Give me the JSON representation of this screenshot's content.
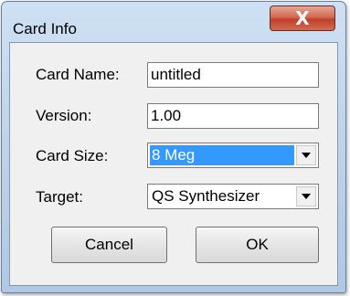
{
  "window": {
    "title": "Card Info",
    "close_label": "X"
  },
  "form": {
    "card_name": {
      "label": "Card Name:",
      "value": "untitled"
    },
    "version": {
      "label": "Version:",
      "value": "1.00"
    },
    "card_size": {
      "label": "Card Size:",
      "value": "8 Meg"
    },
    "target": {
      "label": "Target:",
      "value": "QS Synthesizer"
    }
  },
  "buttons": {
    "cancel": "Cancel",
    "ok": "OK"
  },
  "colors": {
    "selection": "#3399ff",
    "close_button": "#c0402a",
    "frame": "#b9d1ea"
  }
}
